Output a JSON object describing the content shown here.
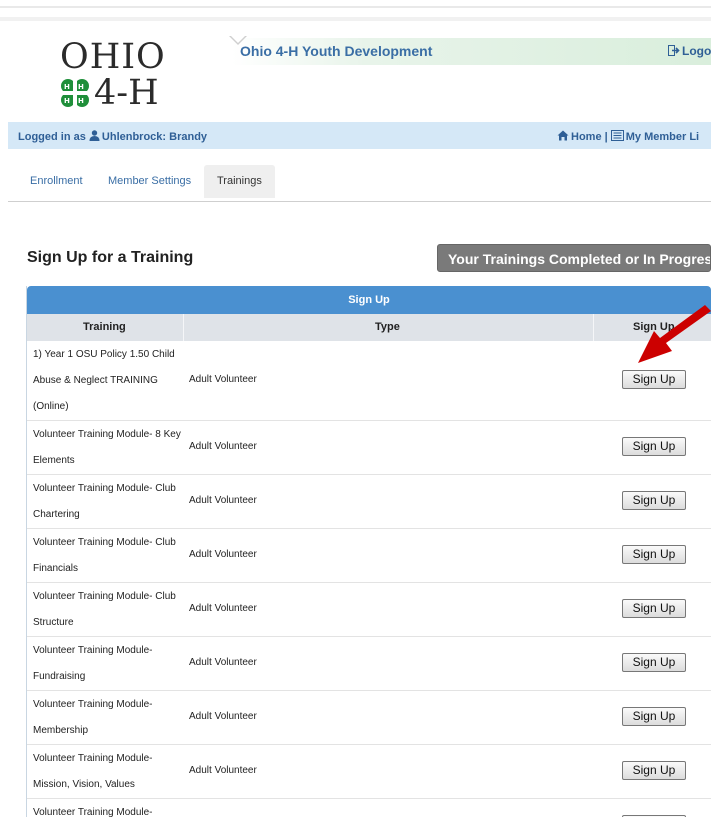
{
  "logo": {
    "word": "OHIO",
    "number": "4-H"
  },
  "header": {
    "title": "Ohio 4-H Youth Development",
    "logout": "Logo"
  },
  "userbar": {
    "logged_in_as": "Logged in as",
    "user": "Uhlenbrock: Brandy",
    "home": "Home",
    "separator": "|",
    "member_list": "My Member Li"
  },
  "tabs": [
    {
      "label": "Enrollment"
    },
    {
      "label": "Member Settings"
    },
    {
      "label": "Trainings"
    }
  ],
  "section_title": "Sign Up for a Training",
  "completed_button": "Your Trainings Completed or In Progress",
  "table": {
    "title": "Sign Up",
    "columns": [
      "Training",
      "Type",
      "Sign Up"
    ],
    "rows": [
      {
        "name": "1) Year 1 OSU Policy 1.50 Child Abuse & Neglect TRAINING (Online)",
        "type": "Adult Volunteer",
        "action": "Sign Up"
      },
      {
        "name": "Volunteer Training Module- 8 Key Elements",
        "type": "Adult Volunteer",
        "action": "Sign Up"
      },
      {
        "name": "Volunteer Training Module- Club Chartering",
        "type": "Adult Volunteer",
        "action": "Sign Up"
      },
      {
        "name": "Volunteer Training Module- Club Financials",
        "type": "Adult Volunteer",
        "action": "Sign Up"
      },
      {
        "name": "Volunteer Training Module- Club Structure",
        "type": "Adult Volunteer",
        "action": "Sign Up"
      },
      {
        "name": "Volunteer Training Module- Fundraising",
        "type": "Adult Volunteer",
        "action": "Sign Up"
      },
      {
        "name": "Volunteer Training Module- Membership",
        "type": "Adult Volunteer",
        "action": "Sign Up"
      },
      {
        "name": "Volunteer Training Module- Mission, Vision, Values",
        "type": "Adult Volunteer",
        "action": "Sign Up"
      },
      {
        "name": "Volunteer Training Module-",
        "type": "",
        "action": "Sign Up"
      }
    ]
  },
  "colors": {
    "header_blue": "#4a90d0",
    "link_blue": "#3a6ea5",
    "arrow_red": "#cc0000",
    "clover_green": "#1f8f3a"
  }
}
